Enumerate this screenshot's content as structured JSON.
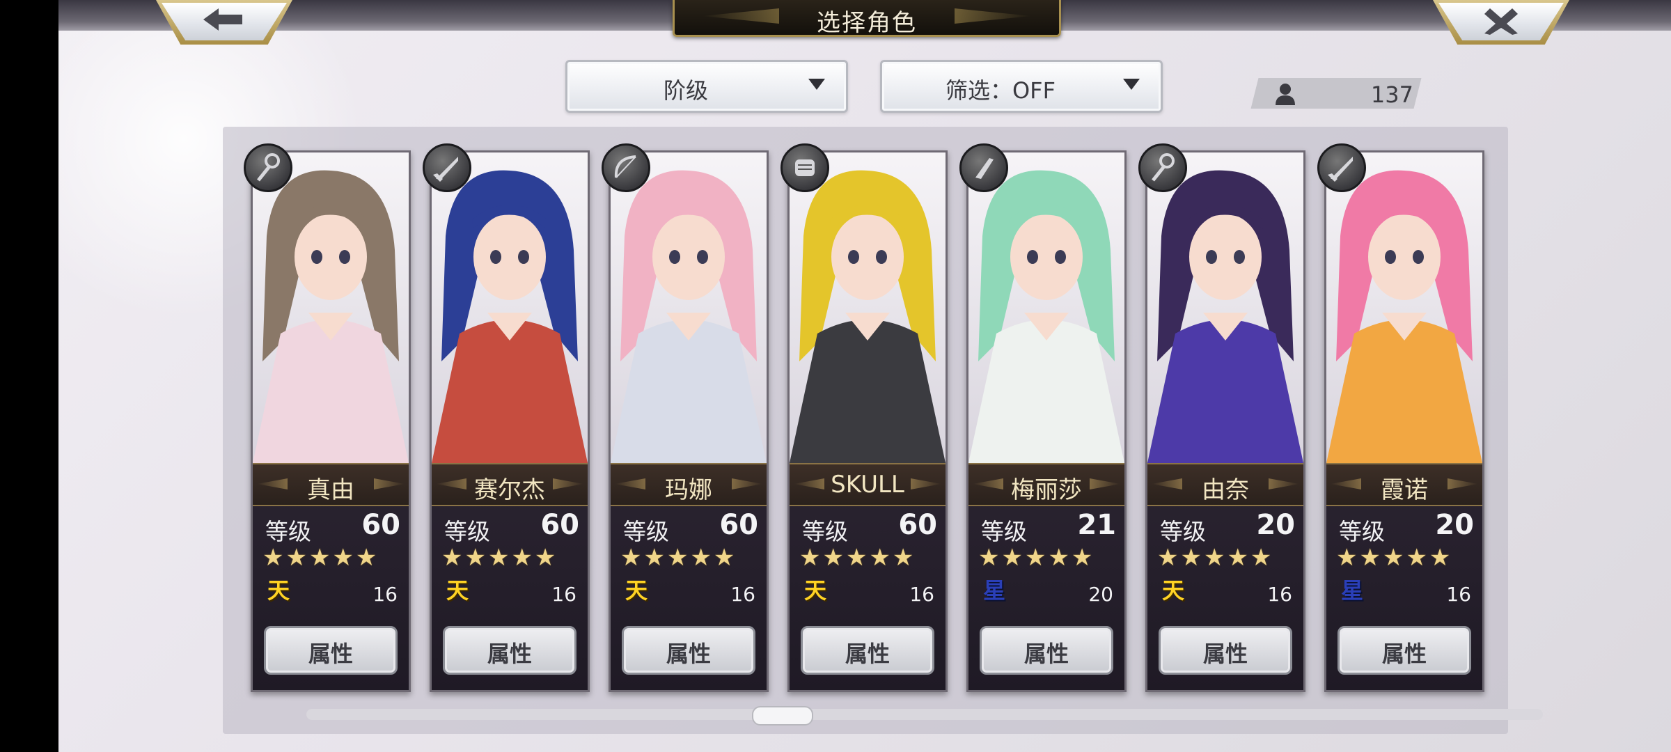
{
  "header": {
    "title": "选择角色",
    "back_glyph": "🡐",
    "close_glyph": "✕"
  },
  "filters": {
    "sort_label": "阶级",
    "filter_label": "筛选：OFF"
  },
  "roster": {
    "count": "137",
    "count_icon": "person-icon"
  },
  "characters": [
    {
      "name": "真由",
      "level_label": "等级",
      "level": "60",
      "stars": "★★★★★",
      "rank_badge": "天",
      "rank_type": "sky",
      "rank_value": "16",
      "button_label": "属性",
      "weapon": "staff",
      "hair": "#8a7868",
      "accent": "#f0d6df"
    },
    {
      "name": "赛尔杰",
      "level_label": "等级",
      "level": "60",
      "stars": "★★★★★",
      "rank_badge": "天",
      "rank_type": "sky",
      "rank_value": "16",
      "button_label": "属性",
      "weapon": "sword",
      "hair": "#2c3f96",
      "accent": "#c64d3f"
    },
    {
      "name": "玛娜",
      "level_label": "等级",
      "level": "60",
      "stars": "★★★★★",
      "rank_badge": "天",
      "rank_type": "sky",
      "rank_value": "16",
      "button_label": "属性",
      "weapon": "bow",
      "hair": "#f1b2c4",
      "accent": "#d8dce8"
    },
    {
      "name": "SKULL",
      "level_label": "等级",
      "level": "60",
      "stars": "★★★★★",
      "rank_badge": "天",
      "rank_type": "sky",
      "rank_value": "16",
      "button_label": "属性",
      "weapon": "fist",
      "hair": "#e4c52b",
      "accent": "#3b3b40"
    },
    {
      "name": "梅丽莎",
      "level_label": "等级",
      "level": "21",
      "stars": "★★★★★",
      "rank_badge": "星",
      "rank_type": "earth",
      "rank_value": "20",
      "button_label": "属性",
      "weapon": "knife",
      "hair": "#8fd8b8",
      "accent": "#eef2ef"
    },
    {
      "name": "由奈",
      "level_label": "等级",
      "level": "20",
      "stars": "★★★★★",
      "rank_badge": "天",
      "rank_type": "sky",
      "rank_value": "16",
      "button_label": "属性",
      "weapon": "staff",
      "hair": "#3a2a5a",
      "accent": "#4d3aa8"
    },
    {
      "name": "霞诺",
      "level_label": "等级",
      "level": "20",
      "stars": "★★★★★",
      "rank_badge": "星",
      "rank_type": "earth",
      "rank_value": "16",
      "button_label": "属性",
      "weapon": "sword",
      "hair": "#f07aa6",
      "accent": "#f2a742"
    }
  ]
}
